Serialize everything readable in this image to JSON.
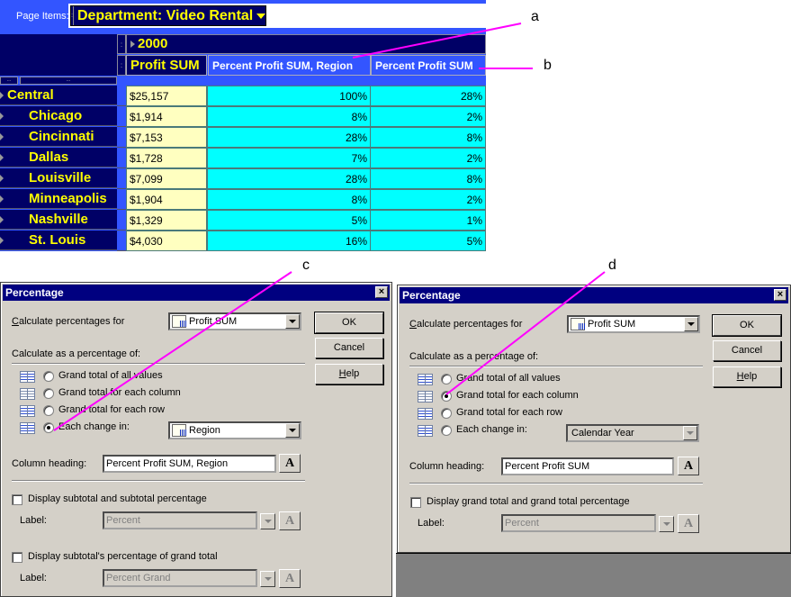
{
  "pivot": {
    "page_items_label": "Page Items:",
    "page_item_value": "Department: Video Rental",
    "column_dimension_value": "2000",
    "column_headers": [
      "Profit SUM",
      "Percent Profit SUM, Region",
      "Percent Profit SUM"
    ],
    "rows": [
      {
        "label": "Central",
        "level": 0,
        "profit": "$25,157",
        "pct_region": "100%",
        "pct_total": "28%"
      },
      {
        "label": "Chicago",
        "level": 1,
        "profit": "$1,914",
        "pct_region": "8%",
        "pct_total": "2%"
      },
      {
        "label": "Cincinnati",
        "level": 1,
        "profit": "$7,153",
        "pct_region": "28%",
        "pct_total": "8%"
      },
      {
        "label": "Dallas",
        "level": 1,
        "profit": "$1,728",
        "pct_region": "7%",
        "pct_total": "2%"
      },
      {
        "label": "Louisville",
        "level": 1,
        "profit": "$7,099",
        "pct_region": "28%",
        "pct_total": "8%"
      },
      {
        "label": "Minneapolis",
        "level": 1,
        "profit": "$1,904",
        "pct_region": "8%",
        "pct_total": "2%"
      },
      {
        "label": "Nashville",
        "level": 1,
        "profit": "$1,329",
        "pct_region": "5%",
        "pct_total": "1%"
      },
      {
        "label": "St. Louis",
        "level": 1,
        "profit": "$4,030",
        "pct_region": "16%",
        "pct_total": "5%"
      }
    ],
    "colors": {
      "header_dark": "#000066",
      "header_blue": "#3355ff",
      "text_yellow": "#ffff00",
      "profit_cell": "#ffffc0",
      "pct_cell": "#00ffff"
    }
  },
  "callouts": {
    "a": "a",
    "b": "b",
    "c": "c",
    "d": "d",
    "color": "#ff00ff"
  },
  "dialog_left": {
    "title": "Percentage",
    "calc_for_label": "Calculate percentages for",
    "calc_for_value": "Profit SUM",
    "calc_as_label": "Calculate as a percentage of:",
    "options": [
      {
        "label": "Grand total of all values",
        "selected": false
      },
      {
        "label": "Grand total for each column",
        "selected": false
      },
      {
        "label": "Grand total for each row",
        "selected": false
      },
      {
        "label": "Each change in:",
        "selected": true
      }
    ],
    "change_in_value": "Region",
    "column_heading_label": "Column heading:",
    "column_heading_value": "Percent Profit SUM, Region",
    "subtotal_check_label": "Display subtotal and subtotal percentage",
    "subtotal_checked": false,
    "label1_label": "Label:",
    "label1_value": "Percent",
    "grand_check_label": "Display subtotal's percentage of grand total",
    "grand_checked": false,
    "label2_label": "Label:",
    "label2_value": "Percent Grand",
    "buttons": {
      "ok": "OK",
      "cancel": "Cancel",
      "help": "Help"
    },
    "font_button": "A"
  },
  "dialog_right": {
    "title": "Percentage",
    "calc_for_label": "Calculate percentages for",
    "calc_for_value": "Profit SUM",
    "calc_as_label": "Calculate as a percentage of:",
    "options": [
      {
        "label": "Grand total of all values",
        "selected": false
      },
      {
        "label": "Grand total for each column",
        "selected": true
      },
      {
        "label": "Grand total for each row",
        "selected": false
      },
      {
        "label": "Each change in:",
        "selected": false
      }
    ],
    "change_in_value": "Calendar Year",
    "column_heading_label": "Column heading:",
    "column_heading_value": "Percent Profit SUM",
    "grand_check_label": "Display grand total and grand total percentage",
    "grand_checked": false,
    "label_label": "Label:",
    "label_value": "Percent",
    "buttons": {
      "ok": "OK",
      "cancel": "Cancel",
      "help": "Help"
    },
    "font_button": "A"
  }
}
